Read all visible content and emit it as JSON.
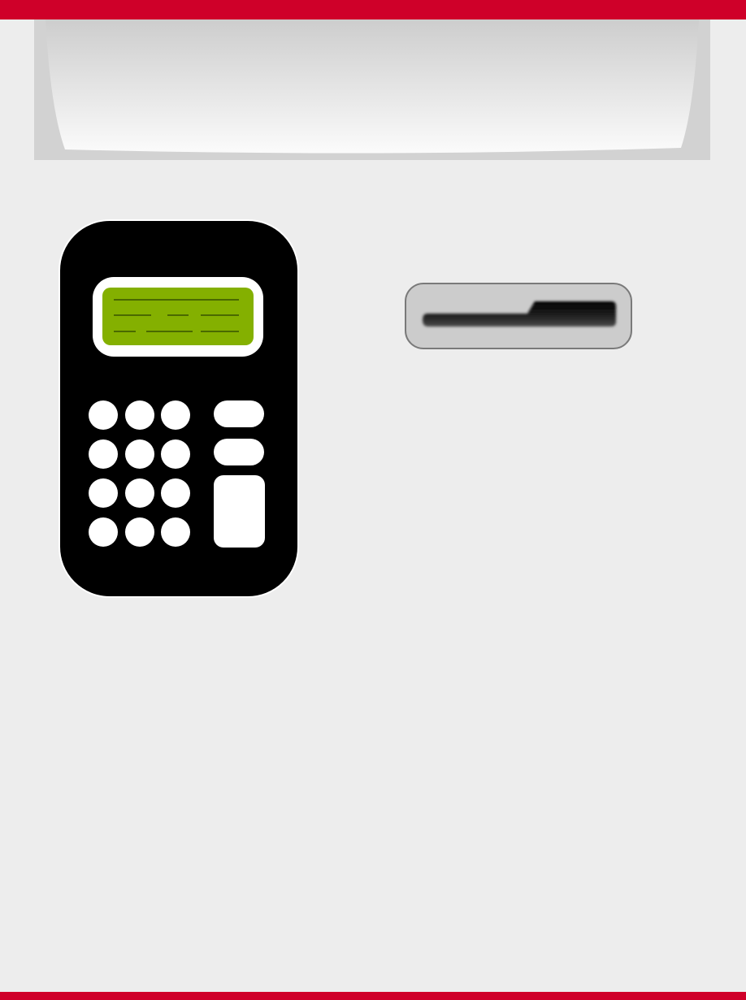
{
  "colors": {
    "accent": "#cf0029",
    "background": "#ededed",
    "terminal_body": "#000000",
    "display_screen": "#84b000",
    "display_lines": "#4a6a00",
    "slot_frame": "#cccccc"
  },
  "icons": {
    "terminal": "payment-terminal-icon",
    "slot": "card-slot-icon"
  },
  "terminal": {
    "keypad_rows": 4,
    "keypad_cols": 3,
    "function_keys": 3
  }
}
